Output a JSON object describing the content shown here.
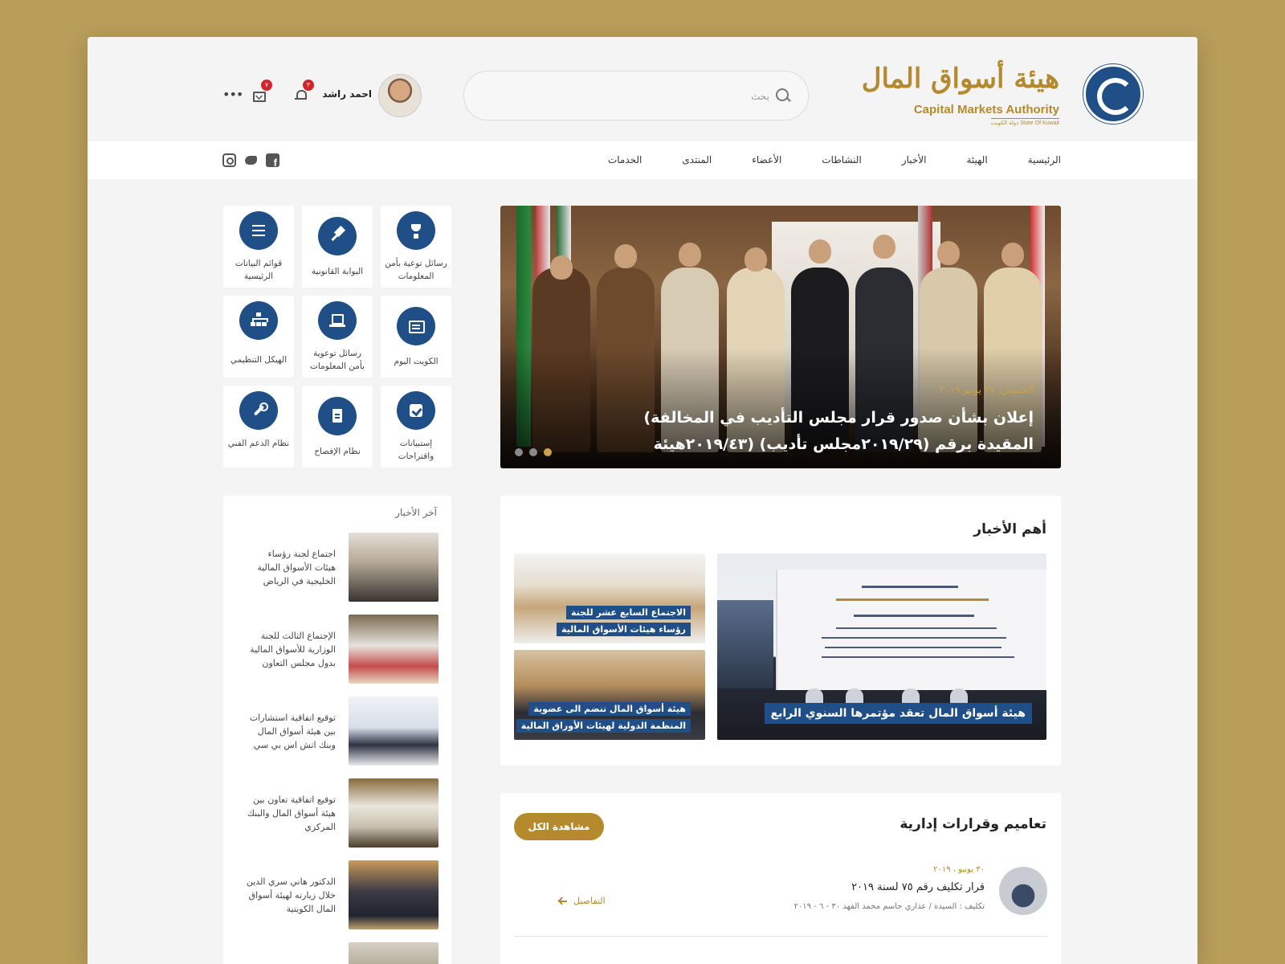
{
  "header": {
    "logo": {
      "ar_name": "هيئة أسواق المال",
      "en_name": "Capital Markets Authority",
      "sub_name": "State Of Kuwait دولة الكويت"
    },
    "search": {
      "placeholder": "بحث"
    },
    "user": {
      "name": "احمد راشد"
    },
    "notifications_count": "٣",
    "messages_count": "٧"
  },
  "nav": {
    "items": [
      "الرئيسية",
      "الهيئة",
      "الأخبار",
      "النشاطات",
      "الأعضاء",
      "المنتدى",
      "الخدمات"
    ],
    "social": [
      "facebook-icon",
      "twitter-icon",
      "instagram-icon"
    ]
  },
  "slider": {
    "date": "الخميس, ٢٧ يونيو ٢٠١٩",
    "title": "إعلان بشأن صدور قرار مجلس التأديب في المخالفة) المقيدة برقم (٢٠١٩/٢٩مجلس تأديب) (٢٠١٩/٤٣هيئة",
    "dots": 3,
    "active_dot": 3
  },
  "quick_links": [
    {
      "label": "رسائل توعية بأمن المعلومات",
      "icon": "trophy-icon"
    },
    {
      "label": "البوابة القانونية",
      "icon": "gavel-icon"
    },
    {
      "label": "قوائم البيانات الرئيسية",
      "icon": "list-icon"
    },
    {
      "label": "الكويت اليوم",
      "icon": "newspaper-icon"
    },
    {
      "label": "رسائل توعوية بأمن المعلومات",
      "icon": "laptop-icon"
    },
    {
      "label": "الهيكل التنظيمي",
      "icon": "org-chart-icon"
    },
    {
      "label": "إستبيانات واقتراحات",
      "icon": "checkbox-icon"
    },
    {
      "label": "نظام الإفصاح",
      "icon": "document-icon"
    },
    {
      "label": "نظام الدعم الفني",
      "icon": "wrench-icon"
    }
  ],
  "latest_news": {
    "title": "آخر الأخبار",
    "items": [
      "اجتماع لجنة رؤساء هيئات الأسواق المالية الخليجية في الرياض",
      "الإجتماع الثالث للجنة الوزارية للأسواق المالية بدول مجلس التعاون",
      "توقيع اتفاقية استشارات بين هيئة أسواق المال وبنك اتش اس بي سي",
      "توقيع اتفاقية تعاون بين هيئة أسواق المال والبنك المركزي",
      "الدكتور هاني سري الدين خلال زيارته لهيئة أسواق المال الكويتية"
    ]
  },
  "top_news": {
    "title": "أهم الأخبار",
    "main": "هيئة أسواق المال تعقد مؤتمرها السنوي الرابع",
    "side1_line1": "الاجتماع السابع عشر للجنة",
    "side1_line2": "رؤساء هيئات الأسواق المالية",
    "side2_line1": "هيئة أسواق المال تنضم الى عضوية",
    "side2_line2": "المنظمة الدولية لهيئات الأوراق المالية"
  },
  "circulars": {
    "title": "تعاميم وقرارات إدارية",
    "view_all": "مشاهدة الكل",
    "item": {
      "date": "٣٠ يونيو ، ٢٠١٩",
      "title": "قرار تكليف رقم ٧٥ لسنة ٢٠١٩",
      "subtitle": "تكليف : السيدة / عذاري جاسم محمد الفهد ٣٠ - ٦ - ٢٠١٩",
      "details": "التفاصيل"
    }
  },
  "colors": {
    "brand_blue": "#1f4f86",
    "brand_gold": "#b48a2d",
    "badge_red": "#d4252d",
    "page_bg": "#f4f4f4"
  }
}
